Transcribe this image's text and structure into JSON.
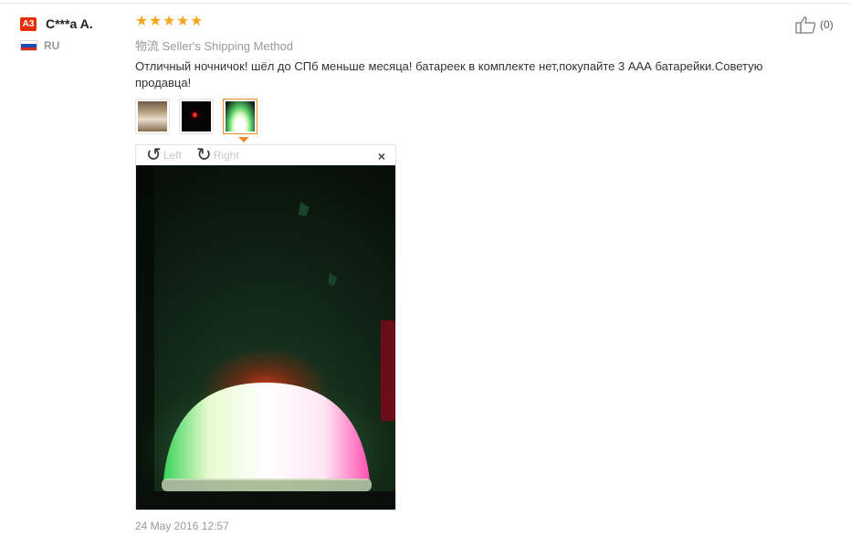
{
  "review": {
    "user": {
      "level_badge": "A3",
      "name": "C***a A.",
      "country": "RU"
    },
    "rating": 5,
    "shipping": "物流 Seller's Shipping Method",
    "text": "Отличный ночничок! шёл до СПб меньше месяца! батареек в комплекте нет,покупайте 3 ААА батарейки.Советую продавца!",
    "thumbnails": [
      {
        "name": "thumbnail-1",
        "active": false
      },
      {
        "name": "thumbnail-2",
        "active": false
      },
      {
        "name": "thumbnail-3",
        "active": true
      }
    ],
    "viewer": {
      "rotate_left_label": "Left",
      "rotate_right_label": "Right",
      "close_symbol": "×"
    },
    "date": "24 May 2016 12:57",
    "helpful": {
      "count_label": "(0)"
    }
  },
  "icons": {
    "star": "star-icon",
    "flag": "russia-flag-icon",
    "rotate_left": "rotate-left-icon",
    "rotate_right": "rotate-right-icon",
    "close": "close-icon",
    "like": "thumbs-up-icon"
  },
  "colors": {
    "badge": "#e62e04",
    "star": "#f5a623",
    "active_thumb_border": "#f08a24",
    "muted_text": "#999999"
  }
}
